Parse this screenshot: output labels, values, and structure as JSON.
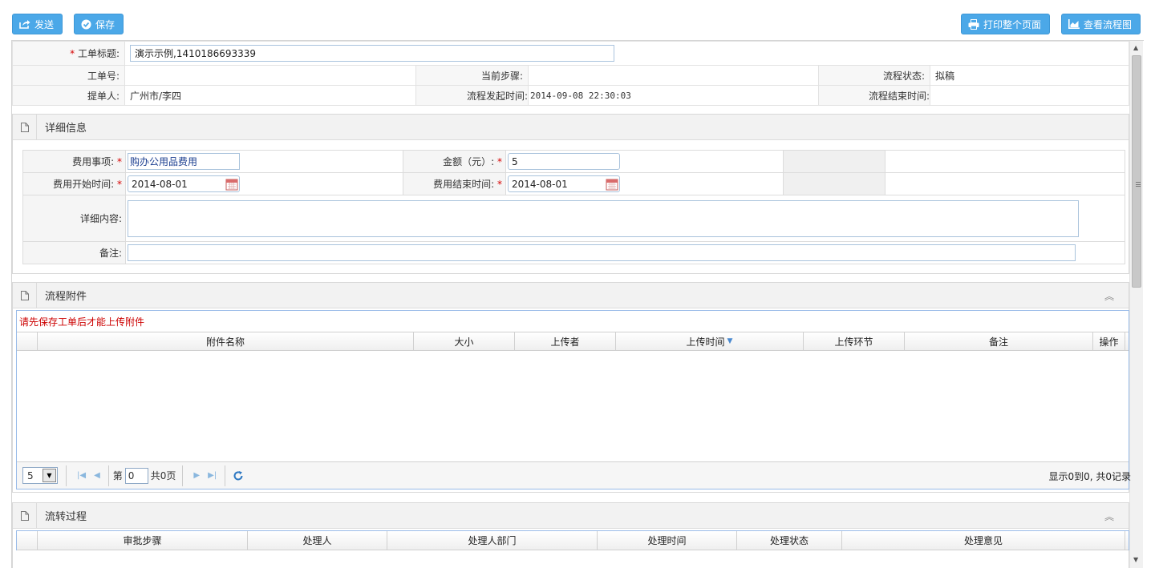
{
  "toolbar": {
    "send_label": "发送",
    "save_label": "保存",
    "print_label": "打印整个页面",
    "flowchart_label": "查看流程图"
  },
  "header": {
    "title_label": "工单标题:",
    "title_value": "演示示例,1410186693339",
    "order_no_label": "工单号:",
    "order_no_value": "",
    "current_step_label": "当前步骤:",
    "current_step_value": "",
    "flow_status_label": "流程状态:",
    "flow_status_value": "拟稿",
    "submitter_label": "提单人:",
    "submitter_value": "广州市/李四",
    "start_time_label": "流程发起时间:",
    "start_time_value": "2014-09-08 22:30:03",
    "end_time_label": "流程结束时间:",
    "end_time_value": ""
  },
  "details": {
    "title": "详细信息",
    "expense_item_label": "费用事项:",
    "expense_item_value": "购办公用品费用",
    "amount_label": "金额（元）:",
    "amount_value": "5",
    "start_date_label": "费用开始时间:",
    "start_date_value": "2014-08-01",
    "end_date_label": "费用结束时间:",
    "end_date_value": "2014-08-01",
    "content_label": "详细内容:",
    "content_value": "",
    "remark_label": "备注:",
    "remark_value": ""
  },
  "attachments": {
    "title": "流程附件",
    "notice": "请先保存工单后才能上传附件",
    "columns": [
      "附件名称",
      "大小",
      "上传者",
      "上传时间",
      "上传环节",
      "备注",
      "操作"
    ],
    "pager": {
      "page_size": "5",
      "page_prefix": "第",
      "page_value": "0",
      "page_total": "共0页",
      "summary": "显示0到0, 共0记录"
    }
  },
  "process": {
    "title": "流转过程",
    "columns": [
      "审批步骤",
      "处理人",
      "处理人部门",
      "处理时间",
      "处理状态",
      "处理意见"
    ]
  },
  "colors": {
    "button": "#4ba8e8",
    "required": "#d60000",
    "notice": "#cc0000",
    "grid_border": "#99bbe8"
  }
}
